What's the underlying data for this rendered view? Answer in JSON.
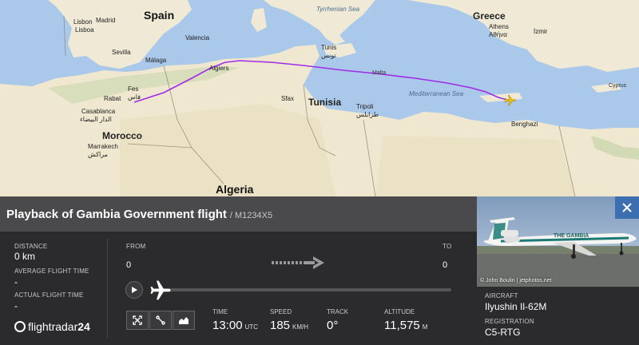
{
  "map": {
    "countries": {
      "spain": "Spain",
      "morocco": "Morocco",
      "algeria": "Algeria",
      "tunisia": "Tunisia",
      "greece": "Greece",
      "libya_city": "Tripoli",
      "libya_city_ar": "طرابلس",
      "malta": "Malta",
      "cyprus": "Cyprus"
    },
    "seas": {
      "tyrrhenian": "Tyrrhenian Sea",
      "mediterranean": "Mediterranean Sea"
    },
    "cities": {
      "lisbon": "Lisbon",
      "lisbon_pt": "Lisboa",
      "madrid": "Madrid",
      "valencia": "Valencia",
      "sevilla": "Sevilla",
      "malaga": "Málaga",
      "fes": "Fes",
      "fes_ar": "فاس",
      "rabat": "Rabat",
      "casablanca": "Casablanca",
      "casablanca_ar": "الدار البيضاء",
      "marrakech": "Marrakech",
      "marrakech_ar": "مراكش",
      "algiers": "Algiers",
      "tunis": "Tunis",
      "tunis_ar": "تونس",
      "sfax": "Sfax",
      "athens": "Athens",
      "athens_gr": "Αθήνα",
      "izmir": "İzmir",
      "benghazi": "Benghazi"
    }
  },
  "panel": {
    "title": "Playback of Gambia Government flight",
    "callsign": "/ M1234X5",
    "stats": {
      "distance_label": "DISTANCE",
      "distance_value": "0 km",
      "avg_time_label": "AVERAGE FLIGHT TIME",
      "avg_time_value": "-",
      "actual_time_label": "ACTUAL FLIGHT TIME",
      "actual_time_value": "-"
    },
    "route": {
      "from_label": "FROM",
      "from_value": "0",
      "to_label": "TO",
      "to_value": "0"
    },
    "telemetry": {
      "time_label": "TIME",
      "time_value": "13:00",
      "time_unit": "UTC",
      "speed_label": "SPEED",
      "speed_value": "185",
      "speed_unit": "KM/H",
      "track_label": "TRACK",
      "track_value": "0°",
      "altitude_label": "ALTITUDE",
      "altitude_value": "11,575",
      "altitude_unit": "M"
    },
    "aircraft": {
      "aircraft_label": "AIRCRAFT",
      "aircraft_value": "Ilyushin Il-62M",
      "registration_label": "REGISTRATION",
      "registration_value": "C5-RTG",
      "photo_credit": "© John Boulin | jetphotos.net",
      "livery_text": "THE GAMBIA"
    },
    "brand": {
      "name_a": "flightradar",
      "name_b": "24"
    },
    "icons": [
      "play-icon",
      "airplane-icon",
      "expand-icon",
      "route-icon",
      "chart-icon",
      "close-icon",
      "arrow-right-icon"
    ],
    "colors": {
      "flight_path": "#a12ce8",
      "aircraft_marker": "#f4c400",
      "close_button": "#3d6fb0",
      "panel_bg": "#2b2b2d",
      "titlebar_bg": "#4a4a4c"
    }
  }
}
